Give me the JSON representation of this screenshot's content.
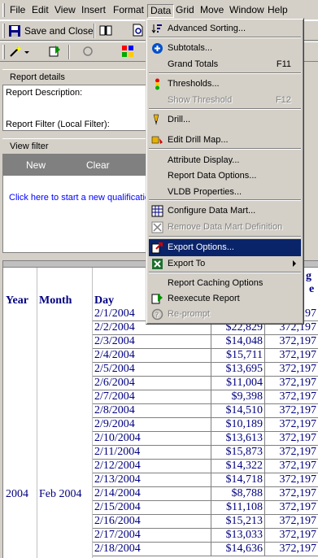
{
  "menubar": {
    "items": [
      "File",
      "Edit",
      "View",
      "Insert",
      "Format",
      "Data",
      "Grid",
      "Move",
      "Window",
      "Help"
    ]
  },
  "toolbar": {
    "save_close_label": "Save and Close"
  },
  "report_details": {
    "title": "Report details",
    "description_label": "Report Description:",
    "filter_label": "Report Filter (Local Filter):"
  },
  "view_filter": {
    "title": "View filter",
    "new_label": "New",
    "clear_label": "Clear",
    "qualification_link": "Click here to start a new qualificatio"
  },
  "data_menu": {
    "items": [
      {
        "label": "Advanced Sorting...",
        "shortcut": "",
        "icon": "sort-icon",
        "disabled": false
      },
      {
        "label": "Subtotals...",
        "shortcut": "",
        "icon": "plus-circle-icon",
        "disabled": false
      },
      {
        "label": "Grand Totals",
        "shortcut": "F11",
        "icon": "",
        "disabled": false
      },
      {
        "label": "Thresholds...",
        "shortcut": "",
        "icon": "thresholds-icon",
        "disabled": false
      },
      {
        "label": "Show Threshold",
        "shortcut": "F12",
        "icon": "",
        "disabled": true
      },
      {
        "label": "Drill...",
        "shortcut": "",
        "icon": "drill-icon",
        "disabled": false
      },
      {
        "label": "Edit Drill Map...",
        "shortcut": "",
        "icon": "drill-map-icon",
        "disabled": false
      },
      {
        "label": "Attribute Display...",
        "shortcut": "",
        "icon": "",
        "disabled": false
      },
      {
        "label": "Report Data Options...",
        "shortcut": "",
        "icon": "",
        "disabled": false
      },
      {
        "label": "VLDB Properties...",
        "shortcut": "",
        "icon": "",
        "disabled": false
      },
      {
        "label": "Configure Data Mart...",
        "shortcut": "",
        "icon": "data-mart-icon",
        "disabled": false
      },
      {
        "label": "Remove Data Mart Definition",
        "shortcut": "",
        "icon": "remove-data-mart-icon",
        "disabled": true
      },
      {
        "label": "Export Options...",
        "shortcut": "",
        "icon": "export-options-icon",
        "disabled": false
      },
      {
        "label": "Export To",
        "shortcut": "",
        "icon": "excel-icon",
        "disabled": false
      },
      {
        "label": "Report Caching Options",
        "shortcut": "",
        "icon": "",
        "disabled": false
      },
      {
        "label": "Reexecute Report",
        "shortcut": "",
        "icon": "reexecute-icon",
        "disabled": false
      },
      {
        "label": "Re-prompt",
        "shortcut": "",
        "icon": "reprompt-icon",
        "disabled": true
      }
    ]
  },
  "grid": {
    "headers": {
      "year": "Year",
      "month": "Month",
      "day": "Day",
      "col4_partial": "g",
      "col4_partial2": "e"
    },
    "year_value": "2004",
    "month_value": "Feb 2004",
    "rows": [
      {
        "day": "2/1/2004",
        "revenue": "",
        "total": "372,197"
      },
      {
        "day": "2/2/2004",
        "revenue": "$22,829",
        "total": "372,197"
      },
      {
        "day": "2/3/2004",
        "revenue": "$14,048",
        "total": "372,197"
      },
      {
        "day": "2/4/2004",
        "revenue": "$15,711",
        "total": "372,197"
      },
      {
        "day": "2/5/2004",
        "revenue": "$13,695",
        "total": "372,197"
      },
      {
        "day": "2/6/2004",
        "revenue": "$11,004",
        "total": "372,197"
      },
      {
        "day": "2/7/2004",
        "revenue": "$9,398",
        "total": "372,197"
      },
      {
        "day": "2/8/2004",
        "revenue": "$14,510",
        "total": "372,197"
      },
      {
        "day": "2/9/2004",
        "revenue": "$10,189",
        "total": "372,197"
      },
      {
        "day": "2/10/2004",
        "revenue": "$13,613",
        "total": "372,197"
      },
      {
        "day": "2/11/2004",
        "revenue": "$15,873",
        "total": "372,197"
      },
      {
        "day": "2/12/2004",
        "revenue": "$14,322",
        "total": "372,197"
      },
      {
        "day": "2/13/2004",
        "revenue": "$14,718",
        "total": "372,197"
      },
      {
        "day": "2/14/2004",
        "revenue": "$8,788",
        "total": "372,197"
      },
      {
        "day": "2/15/2004",
        "revenue": "$11,108",
        "total": "372,197"
      },
      {
        "day": "2/16/2004",
        "revenue": "$15,213",
        "total": "372,197"
      },
      {
        "day": "2/17/2004",
        "revenue": "$13,033",
        "total": "372,197"
      },
      {
        "day": "2/18/2004",
        "revenue": "$14,636",
        "total": "372,197"
      }
    ]
  }
}
